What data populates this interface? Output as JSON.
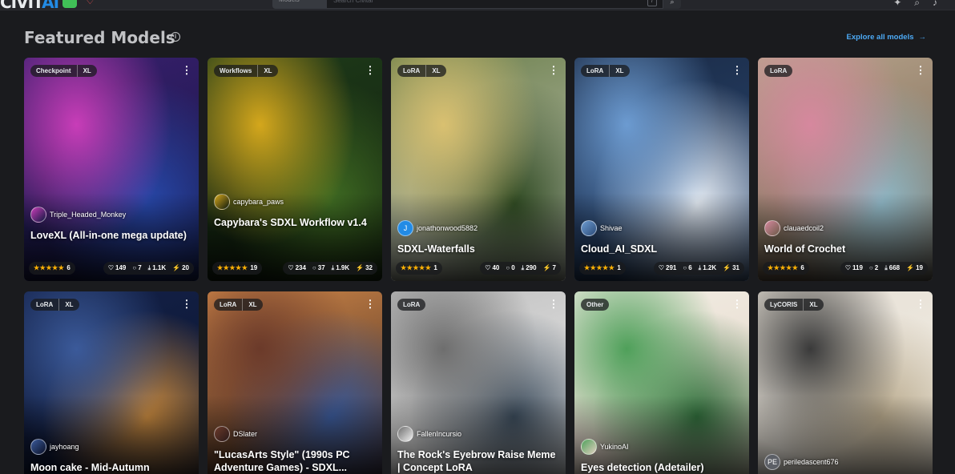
{
  "header": {
    "logo_main": "CIVIT",
    "logo_ai": "AI",
    "search_select": "Models",
    "search_placeholder": "Search Civitai",
    "search_shortcut": "/",
    "icons": [
      "magnifier-icon",
      "filter-icon",
      "search-icon",
      "bell-icon"
    ]
  },
  "section": {
    "title": "Featured Models",
    "explore_label": "Explore all models"
  },
  "cards": [
    {
      "badges": [
        "Checkpoint",
        "XL"
      ],
      "creator": "Triple_Headed_Monkey",
      "avatar": "",
      "title": "LoveXL (All-in-one mega update)",
      "rating": "6",
      "likes": "149",
      "comments": "7",
      "downloads": "1.1K",
      "buzz": "20",
      "colors": [
        "#3a1f6e",
        "#c83db8",
        "#2747a8",
        "#0f1740"
      ]
    },
    {
      "badges": [
        "Workflows",
        "XL"
      ],
      "creator": "capybara_paws",
      "avatar": "",
      "title": "Capybara's SDXL Workflow v1.4",
      "rating": "19",
      "likes": "234",
      "comments": "37",
      "downloads": "1.9K",
      "buzz": "32",
      "colors": [
        "#1f3c1a",
        "#d4a71c",
        "#3f6b22",
        "#0e1a0c"
      ]
    },
    {
      "badges": [
        "LoRA",
        "XL"
      ],
      "creator": "jonathonwood5882",
      "avatar": "J",
      "title": "SDXL-Waterfalls",
      "rating": "1",
      "likes": "40",
      "comments": "0",
      "downloads": "290",
      "buzz": "7",
      "colors": [
        "#6b7f4a",
        "#d9c070",
        "#2f4a22",
        "#c9c9c2"
      ]
    },
    {
      "badges": [
        "LoRA",
        "XL"
      ],
      "creator": "Shivae",
      "avatar": "",
      "title": "Cloud_AI_SDXL",
      "rating": "1",
      "likes": "291",
      "comments": "6",
      "downloads": "1.2K",
      "buzz": "31",
      "colors": [
        "#1a2a45",
        "#6c9bd1",
        "#e5ecf4",
        "#2d4d7a"
      ]
    },
    {
      "badges": [
        "LoRA"
      ],
      "creator": "clauaedcoil2",
      "avatar": "",
      "title": "World of Crochet",
      "rating": "6",
      "likes": "119",
      "comments": "2",
      "downloads": "668",
      "buzz": "19",
      "colors": [
        "#b8a48c",
        "#d6889e",
        "#8fb8c7",
        "#6b5a48"
      ]
    },
    {
      "badges": [
        "LoRA",
        "XL"
      ],
      "creator": "jayhoang",
      "avatar": "",
      "title": "Moon cake - Mid-Autumn",
      "colors": [
        "#14224a",
        "#3b5a9a",
        "#c98a3f",
        "#0a1128"
      ]
    },
    {
      "badges": [
        "LoRA",
        "XL"
      ],
      "creator": "DSlater",
      "avatar": "",
      "title": "\"LucasArts Style\" (1990s PC Adventure Games) - SDXL...",
      "colors": [
        "#d48a4a",
        "#6b3a2a",
        "#3a5a9a",
        "#2a1a1a"
      ]
    },
    {
      "badges": [
        "LoRA"
      ],
      "creator": "FallenIncursio",
      "avatar": "",
      "title": "The Rock's Eyebrow Raise Meme | Concept LoRA",
      "colors": [
        "#bfbfbf",
        "#6e6e6e",
        "#3a4a5a",
        "#f0f0f0"
      ]
    },
    {
      "badges": [
        "Other"
      ],
      "creator": "YukinoAI",
      "avatar": "",
      "title": "Eyes detection (Adetailer)",
      "colors": [
        "#f3efe6",
        "#4fa05a",
        "#2f6b3a",
        "#e0cfc0"
      ]
    },
    {
      "badges": [
        "LyCORIS",
        "XL"
      ],
      "creator": "periledascent676",
      "avatar": "PE",
      "title": "",
      "colors": [
        "#e6e0d6",
        "#3a3a3a",
        "#b8a98c",
        "#f5f0e6"
      ]
    }
  ]
}
